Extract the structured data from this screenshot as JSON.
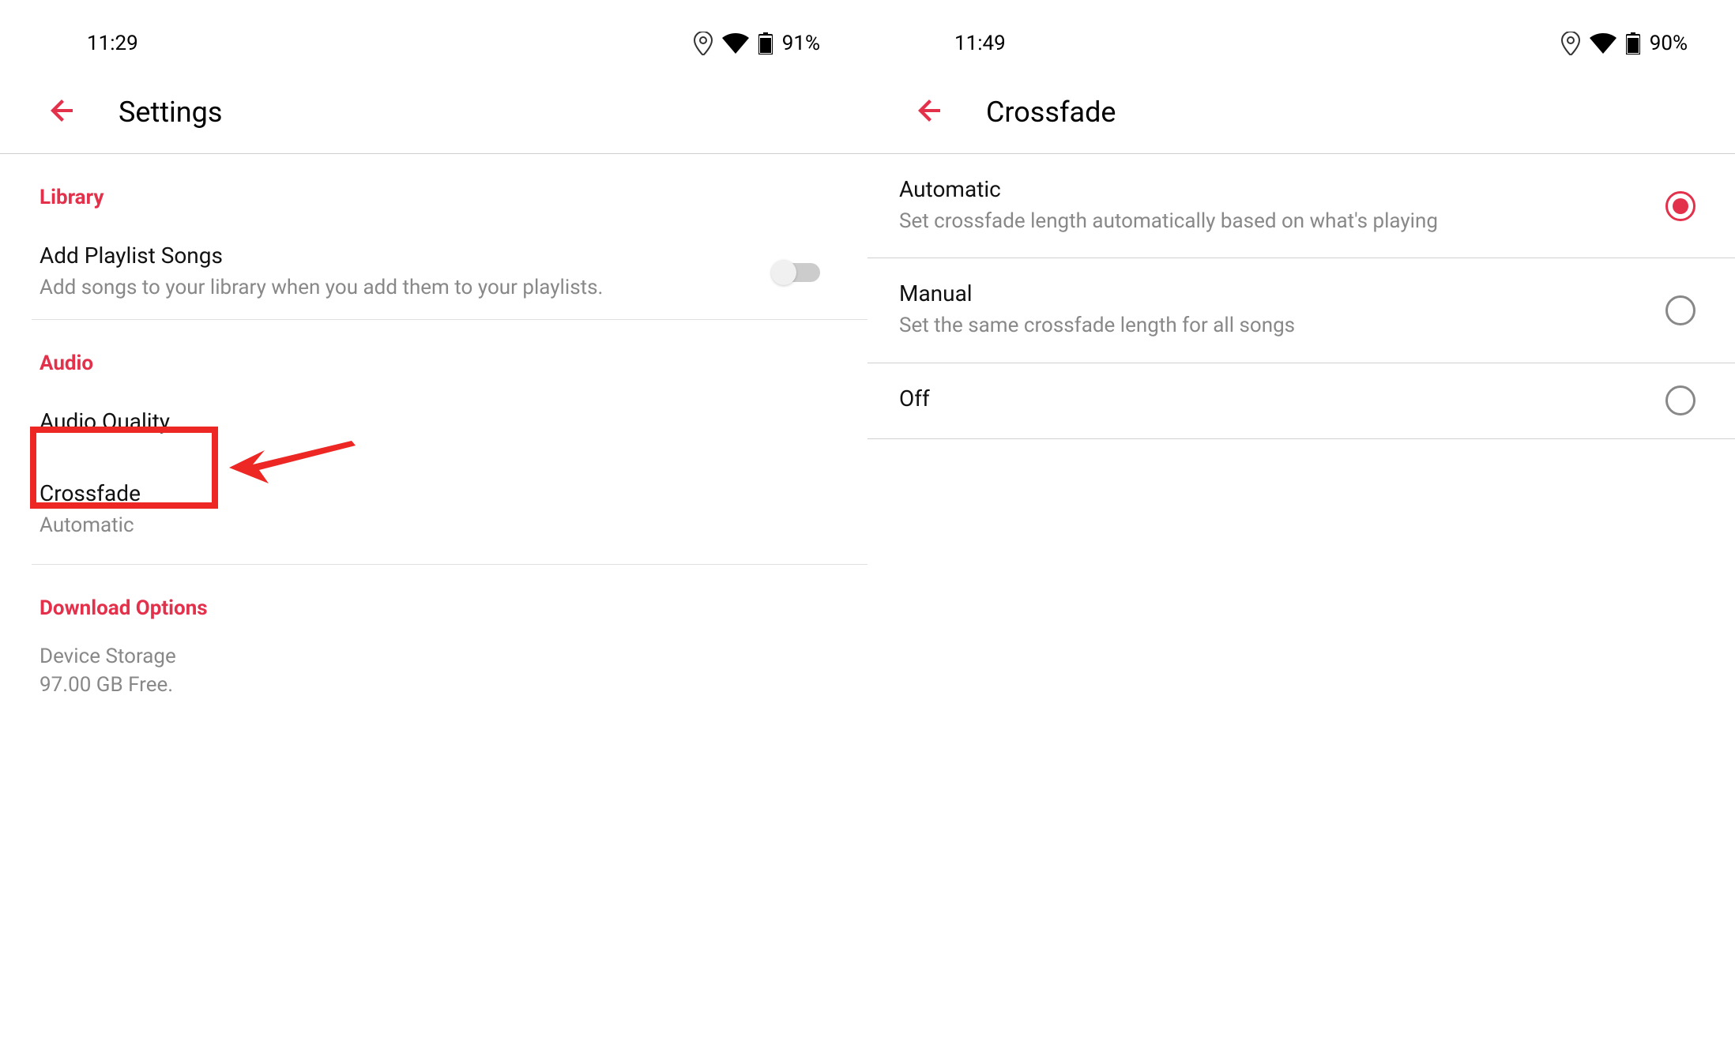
{
  "screen1": {
    "status": {
      "time": "11:29",
      "battery": "91%"
    },
    "title": "Settings",
    "sections": {
      "library": {
        "header": "Library",
        "addPlaylist": {
          "title": "Add Playlist Songs",
          "subtitle": "Add songs to your library when you add them to your playlists."
        }
      },
      "audio": {
        "header": "Audio",
        "audioQuality": {
          "title": "Audio Quality"
        },
        "crossfade": {
          "title": "Crossfade",
          "subtitle": "Automatic"
        }
      },
      "download": {
        "header": "Download Options",
        "storage": {
          "title": "Device Storage",
          "subtitle": "97.00 GB Free."
        }
      }
    }
  },
  "screen2": {
    "status": {
      "time": "11:49",
      "battery": "90%"
    },
    "title": "Crossfade",
    "options": {
      "automatic": {
        "title": "Automatic",
        "subtitle": "Set crossfade length automatically based on what's playing"
      },
      "manual": {
        "title": "Manual",
        "subtitle": "Set the same crossfade length for all songs"
      },
      "off": {
        "title": "Off"
      }
    }
  }
}
